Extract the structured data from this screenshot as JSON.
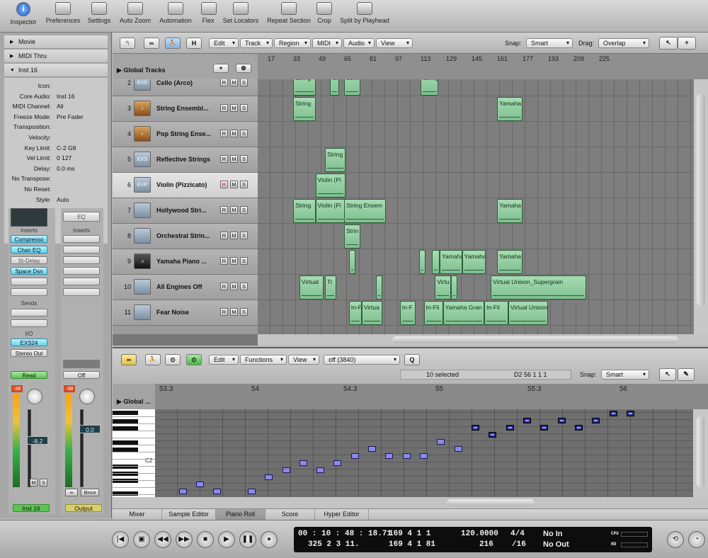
{
  "toolbar": {
    "buttons": [
      {
        "label": "Inspector",
        "icon": "info-icon"
      },
      {
        "label": "Preferences",
        "icon": "preferences-icon"
      },
      {
        "label": "Settings",
        "icon": "settings-icon"
      },
      {
        "label": "Auto Zoom",
        "icon": "auto-zoom-icon"
      },
      {
        "label": "Automation",
        "icon": "automation-icon"
      },
      {
        "label": "Flex",
        "icon": "flex-icon"
      },
      {
        "label": "Set Locators",
        "icon": "set-locators-icon"
      },
      {
        "label": "Repeat Section",
        "icon": "repeat-section-icon"
      },
      {
        "label": "Crop",
        "icon": "crop-icon"
      },
      {
        "label": "Split by Playhead",
        "icon": "split-icon"
      }
    ]
  },
  "inspector": {
    "sections": [
      "Movie",
      "MIDI Thru",
      "Inst 16"
    ],
    "params": [
      {
        "label": "Icon:",
        "value": ""
      },
      {
        "label": "Core Audio:",
        "value": "Inst 16"
      },
      {
        "label": "MIDI Channel:",
        "value": "All"
      },
      {
        "label": "Freeze Mode:",
        "value": "Pre Fader"
      },
      {
        "label": "Transposition:",
        "value": ""
      },
      {
        "label": "Velocity:",
        "value": ""
      },
      {
        "label": "Key Limit:",
        "value": "C-2   G8"
      },
      {
        "label": "Vel Limit:",
        "value": "0     127"
      },
      {
        "label": "Delay:",
        "value": "0.0 ms"
      },
      {
        "label": "No Transpose:",
        "value": ""
      },
      {
        "label": "No Reset:",
        "value": ""
      },
      {
        "label": "Style:",
        "value": "Auto"
      }
    ],
    "strip1": {
      "inserts_label": "Inserts",
      "inserts": [
        "Compresso",
        "Chan EQ",
        "St-Delay",
        "Space Dsn"
      ],
      "sends_label": "Sends",
      "io_label": "I/O",
      "input": "EXS24",
      "output": "Stereo Out",
      "automation": "Read",
      "peak": "-38",
      "volume": "-8.2",
      "mute": "M",
      "solo": "S",
      "name": "Inst 16"
    },
    "strip2": {
      "eq": "EQ",
      "inserts_label": "Inserts",
      "automation": "Off",
      "peak": "-38",
      "volume": "0.0",
      "bounce": "Bnce",
      "name": "Output"
    }
  },
  "arrange": {
    "menus": [
      "Edit",
      "Track",
      "Region",
      "MIDI",
      "Audio",
      "View"
    ],
    "h_button": "H",
    "snap_label": "Snap:",
    "snap_value": "Smart",
    "drag_label": "Drag:",
    "drag_value": "Overlap",
    "global_tracks": "Global Tracks",
    "ruler": [
      "17",
      "33",
      "49",
      "65",
      "81",
      "97",
      "113",
      "129",
      "145",
      "161",
      "177",
      "193",
      "209",
      "225"
    ],
    "tracks": [
      {
        "num": "2",
        "name": "Cello (Arco)",
        "icon": "EXS"
      },
      {
        "num": "3",
        "name": "String Ensembl...",
        "icon": "violin"
      },
      {
        "num": "4",
        "name": "Pop String Ense...",
        "icon": "violin"
      },
      {
        "num": "5",
        "name": "Reflective Strings",
        "icon": "EXS"
      },
      {
        "num": "6",
        "name": "Violin (Pizzicato)",
        "icon": "EVP"
      },
      {
        "num": "7",
        "name": "Hollywood Stri...",
        "icon": "synth"
      },
      {
        "num": "8",
        "name": "Orchestral Strin...",
        "icon": "synth"
      },
      {
        "num": "9",
        "name": "Yamaha Piano ...",
        "icon": "piano"
      },
      {
        "num": "10",
        "name": "All Engines Off",
        "icon": "synth"
      },
      {
        "num": "11",
        "name": "Fear Noise",
        "icon": "synth"
      }
    ],
    "rms": [
      "R",
      "M",
      "S"
    ],
    "regions": [
      {
        "track": 0,
        "start": 33,
        "end": 47,
        "name": "String"
      },
      {
        "track": 0,
        "start": 56,
        "end": 62,
        "name": "Glis"
      },
      {
        "track": 0,
        "start": 65,
        "end": 75,
        "name": "Strin"
      },
      {
        "track": 0,
        "start": 113,
        "end": 124,
        "name": "String"
      },
      {
        "track": 1,
        "start": 33,
        "end": 47,
        "name": "String"
      },
      {
        "track": 1,
        "start": 161,
        "end": 177,
        "name": "Yamaha"
      },
      {
        "track": 3,
        "start": 53,
        "end": 66,
        "name": "String"
      },
      {
        "track": 4,
        "start": 47,
        "end": 66,
        "name": "Violin (Pi"
      },
      {
        "track": 5,
        "start": 33,
        "end": 47,
        "name": "String"
      },
      {
        "track": 5,
        "start": 47,
        "end": 66,
        "name": "Violin (Pi"
      },
      {
        "track": 5,
        "start": 65,
        "end": 91,
        "name": "String Ensem"
      },
      {
        "track": 5,
        "start": 161,
        "end": 177,
        "name": "Yamaha"
      },
      {
        "track": 6,
        "start": 65,
        "end": 75,
        "name": "Strin"
      },
      {
        "track": 7,
        "start": 68,
        "end": 72,
        "name": ""
      },
      {
        "track": 7,
        "start": 112,
        "end": 116,
        "name": ""
      },
      {
        "track": 7,
        "start": 120,
        "end": 125,
        "name": ""
      },
      {
        "track": 7,
        "start": 125,
        "end": 139,
        "name": "Yamaha"
      },
      {
        "track": 7,
        "start": 139,
        "end": 154,
        "name": "Yamaha"
      },
      {
        "track": 7,
        "start": 161,
        "end": 177,
        "name": "Yamaha"
      },
      {
        "track": 8,
        "start": 37,
        "end": 52,
        "name": "Virtual"
      },
      {
        "track": 8,
        "start": 53,
        "end": 60,
        "name": "Tr"
      },
      {
        "track": 8,
        "start": 85,
        "end": 89,
        "name": ""
      },
      {
        "track": 8,
        "start": 122,
        "end": 132,
        "name": "Virtu"
      },
      {
        "track": 8,
        "start": 132,
        "end": 136,
        "name": ""
      },
      {
        "track": 8,
        "start": 157,
        "end": 217,
        "name": "Virtual Unison_Supergrain"
      },
      {
        "track": 9,
        "start": 68,
        "end": 76,
        "name": "In-F"
      },
      {
        "track": 9,
        "start": 76,
        "end": 89,
        "name": "Virtua"
      },
      {
        "track": 9,
        "start": 100,
        "end": 110,
        "name": "In-F"
      },
      {
        "track": 9,
        "start": 115,
        "end": 127,
        "name": "In-Fli"
      },
      {
        "track": 9,
        "start": 127,
        "end": 153,
        "name": "Yamaha Gran"
      },
      {
        "track": 9,
        "start": 153,
        "end": 168,
        "name": "In-Fli"
      },
      {
        "track": 9,
        "start": 168,
        "end": 193,
        "name": "Virtual Unison"
      }
    ]
  },
  "editor": {
    "menus": [
      "Edit",
      "Functions",
      "View"
    ],
    "quantize": "off (3840)",
    "q_button": "Q",
    "selected": "10 selected",
    "position": "D2   56 1 1 1",
    "snap_label": "Snap:",
    "snap_value": "Smart",
    "global": "Global ...",
    "ruler": [
      "53.3",
      "54",
      "54.3",
      "55",
      "55.3",
      "56"
    ],
    "key_label": "C2",
    "notes": [
      {
        "x": 0.06,
        "row": 11,
        "selected": false
      },
      {
        "x": 0.092,
        "row": 10,
        "selected": false
      },
      {
        "x": 0.124,
        "row": 11,
        "selected": false
      },
      {
        "x": 0.188,
        "row": 11,
        "selected": false
      },
      {
        "x": 0.22,
        "row": 9,
        "selected": false
      },
      {
        "x": 0.252,
        "row": 8,
        "selected": false
      },
      {
        "x": 0.284,
        "row": 7,
        "selected": false
      },
      {
        "x": 0.316,
        "row": 8,
        "selected": false
      },
      {
        "x": 0.348,
        "row": 7,
        "selected": false
      },
      {
        "x": 0.38,
        "row": 6,
        "selected": false
      },
      {
        "x": 0.412,
        "row": 5,
        "selected": false
      },
      {
        "x": 0.444,
        "row": 6,
        "selected": false
      },
      {
        "x": 0.476,
        "row": 6,
        "selected": false
      },
      {
        "x": 0.508,
        "row": 6,
        "selected": false
      },
      {
        "x": 0.54,
        "row": 4,
        "selected": false
      },
      {
        "x": 0.572,
        "row": 5,
        "selected": false
      },
      {
        "x": 0.604,
        "row": 2,
        "selected": true
      },
      {
        "x": 0.636,
        "row": 3,
        "selected": true
      },
      {
        "x": 0.668,
        "row": 2,
        "selected": true
      },
      {
        "x": 0.7,
        "row": 1,
        "selected": true
      },
      {
        "x": 0.732,
        "row": 2,
        "selected": true
      },
      {
        "x": 0.764,
        "row": 1,
        "selected": true
      },
      {
        "x": 0.796,
        "row": 2,
        "selected": true
      },
      {
        "x": 0.828,
        "row": 1,
        "selected": true
      },
      {
        "x": 0.86,
        "row": 0,
        "selected": true
      },
      {
        "x": 0.892,
        "row": 0,
        "selected": true
      }
    ],
    "tabs": [
      "Mixer",
      "Sample Editor",
      "Piano Roll",
      "Score",
      "Hyper Editor"
    ],
    "active_tab": "Piano Roll"
  },
  "transport": {
    "smpte": "00 : 10 : 48 : 18.71",
    "smpte2": "325   2   3   11.",
    "bars1": "169    4    1      1",
    "bars2": "169    4    1    81",
    "tempo": "120.0000",
    "tempo2": "216",
    "sig": "4/4",
    "div": "/16",
    "in": "No In",
    "out": "No Out",
    "cpu": "CPU",
    "hd": "HD"
  }
}
